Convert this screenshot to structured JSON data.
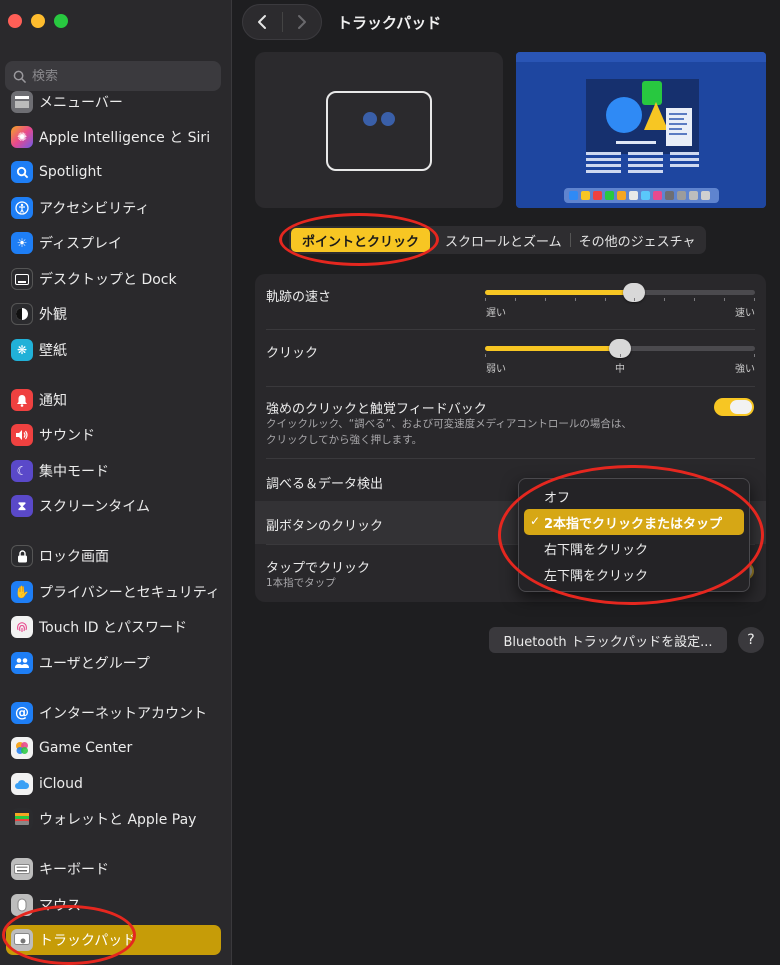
{
  "window": {
    "title": "トラックパッド"
  },
  "search": {
    "placeholder": "検索"
  },
  "sidebar": {
    "items": [
      {
        "label": "メニューバー",
        "icon": "menubar-icon",
        "color": "#6e6e73"
      },
      {
        "label": "Apple Intelligence と Siri",
        "icon": "siri-icon",
        "color": "#e8498e"
      },
      {
        "label": "Spotlight",
        "icon": "spotlight-icon",
        "color": "#1e7ef5"
      },
      {
        "label": "アクセシビリティ",
        "icon": "accessibility-icon",
        "color": "#1e7ef5"
      },
      {
        "label": "ディスプレイ",
        "icon": "display-icon",
        "color": "#1e7ef5"
      },
      {
        "label": "デスクトップと Dock",
        "icon": "dock-icon",
        "color": "#2b2b2e"
      },
      {
        "label": "外観",
        "icon": "appearance-icon",
        "color": "#2b2b2e"
      },
      {
        "label": "壁紙",
        "icon": "wallpaper-icon",
        "color": "#21b1d8"
      },
      {
        "label": "通知",
        "icon": "notifications-icon",
        "color": "#ef4140"
      },
      {
        "label": "サウンド",
        "icon": "sound-icon",
        "color": "#ef4140"
      },
      {
        "label": "集中モード",
        "icon": "focus-icon",
        "color": "#5a49c9"
      },
      {
        "label": "スクリーンタイム",
        "icon": "screentime-icon",
        "color": "#5a49c9"
      },
      {
        "label": "ロック画面",
        "icon": "lock-icon",
        "color": "#2b2b2e"
      },
      {
        "label": "プライバシーとセキュリティ",
        "icon": "privacy-hand-icon",
        "color": "#1e7ef5"
      },
      {
        "label": "Touch ID とパスワード",
        "icon": "fingerprint-icon",
        "color": "#f2f2f2"
      },
      {
        "label": "ユーザとグループ",
        "icon": "users-icon",
        "color": "#1e7ef5"
      },
      {
        "label": "インターネットアカウント",
        "icon": "at-icon",
        "color": "#1e7ef5"
      },
      {
        "label": "Game Center",
        "icon": "gamecenter-icon",
        "color": "#f2f2f2"
      },
      {
        "label": "iCloud",
        "icon": "icloud-icon",
        "color": "#f2f2f2"
      },
      {
        "label": "ウォレットと Apple Pay",
        "icon": "wallet-icon",
        "color": "#2b2b2e"
      },
      {
        "label": "キーボード",
        "icon": "keyboard-icon",
        "color": "#bdbdbd"
      },
      {
        "label": "マウス",
        "icon": "mouse-icon",
        "color": "#bdbdbd"
      },
      {
        "label": "トラックパッド",
        "icon": "trackpad-icon",
        "color": "#bdbdbd"
      }
    ]
  },
  "tabs": [
    {
      "label": "ポイントとクリック",
      "active": true
    },
    {
      "label": "スクロールとズーム",
      "active": false
    },
    {
      "label": "その他のジェスチャ",
      "active": false
    }
  ],
  "settings": {
    "tracking_speed": {
      "label": "軌跡の速さ",
      "value_fraction": 0.55,
      "min_label": "遅い",
      "max_label": "速い"
    },
    "click": {
      "label": "クリック",
      "value_fraction": 0.5,
      "min_label": "弱い",
      "mid_label": "中",
      "max_label": "強い"
    },
    "force_click": {
      "label": "強めのクリックと触覚フィードバック",
      "desc_line1": "クイックルック、“調べる”、および可変速度メディアコントロールの場合は、",
      "desc_line2": "クリックしてから強く押します。",
      "enabled": true
    },
    "lookup": {
      "label": "調べる＆データ検出"
    },
    "secondary_click": {
      "label": "副ボタンのクリック"
    },
    "tap_to_click": {
      "label": "タップでクリック",
      "sub": "1本指でタップ"
    }
  },
  "secondary_click_menu": {
    "options": [
      "オフ",
      "2本指でクリックまたはタップ",
      "右下隅をクリック",
      "左下隅をクリック"
    ],
    "selected_index": 1
  },
  "buttons": {
    "bluetooth": "Bluetooth トラックパッドを設定...",
    "help": "?"
  },
  "colors": {
    "accent": "#f7c623",
    "annotation": "#e5271f"
  }
}
